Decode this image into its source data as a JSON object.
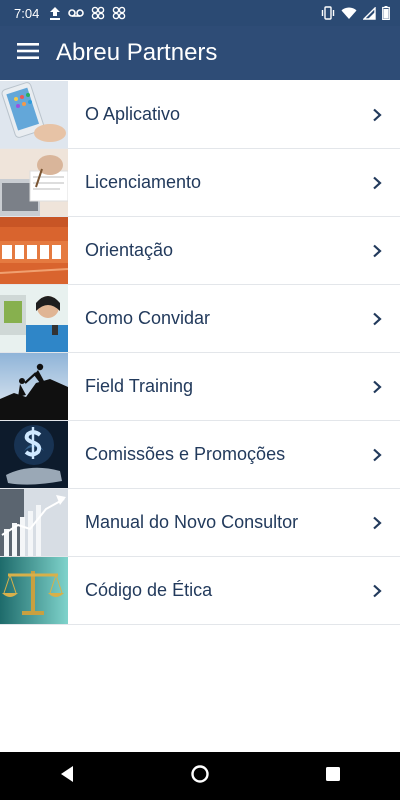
{
  "status_bar": {
    "time": "7:04",
    "left_icons": [
      "upload-icon",
      "voicemail-icon",
      "app-notification-icon",
      "app-notification-icon"
    ],
    "right_icons": [
      "vibrate-icon",
      "wifi-icon",
      "signal-icon",
      "battery-icon"
    ]
  },
  "app_bar": {
    "title": "Abreu Partners",
    "menu_icon": "hamburger-menu-icon"
  },
  "menu": {
    "items": [
      {
        "label": "O Aplicativo",
        "image": "smartphone-photo"
      },
      {
        "label": "Licenciamento",
        "image": "writing-notebook-photo"
      },
      {
        "label": "Orientação",
        "image": "start-track-photo"
      },
      {
        "label": "Como Convidar",
        "image": "woman-phone-photo"
      },
      {
        "label": "Field Training",
        "image": "climbers-silhouette-photo"
      },
      {
        "label": "Comissões e Promoções",
        "image": "dollar-hand-photo"
      },
      {
        "label": "Manual do Novo Consultor",
        "image": "business-chart-photo"
      },
      {
        "label": "Código de Ética",
        "image": "scales-of-justice-photo"
      }
    ]
  },
  "navigation_bar": {
    "buttons": [
      "back-icon",
      "home-icon",
      "recents-icon"
    ]
  },
  "colors": {
    "app_bar": "#2e4c76",
    "status_bar": "#2b4a73",
    "item_text": "#223a5c",
    "divider": "#e3e6ea"
  }
}
